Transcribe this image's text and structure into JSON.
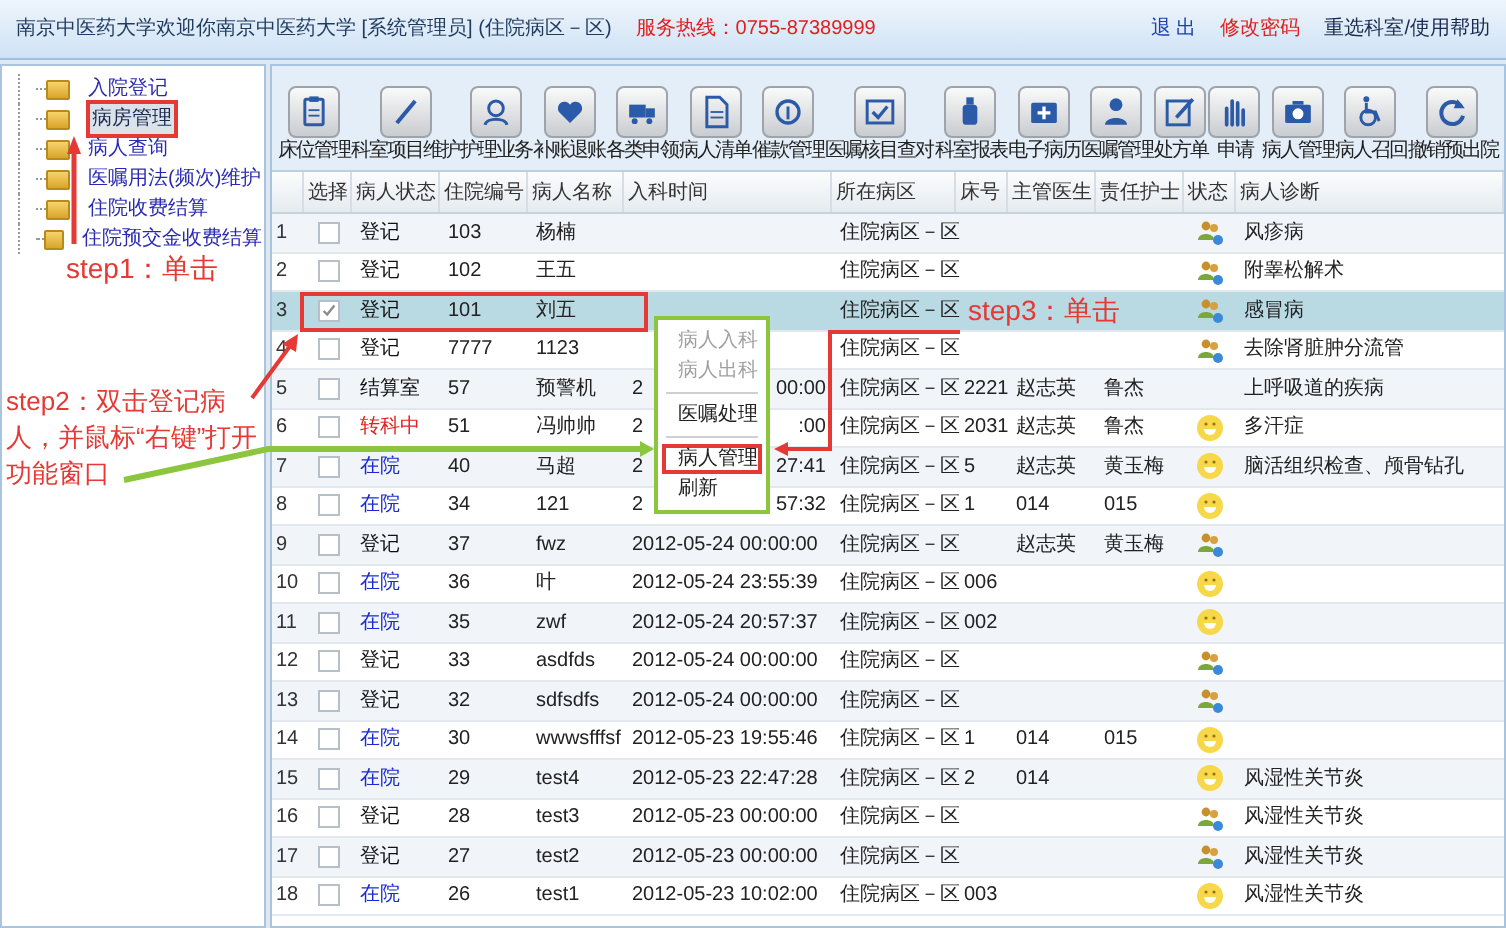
{
  "header": {
    "title": "南京中医药大学欢迎你南京中医药大学 [系统管理员] (住院病区－区)",
    "hotline": "服务热线：0755-87389999",
    "links": [
      "退 出",
      "修改密码",
      "重选科室/使用帮助"
    ]
  },
  "tree": {
    "items": [
      {
        "label": "入院登记",
        "selected": false
      },
      {
        "label": "病房管理",
        "selected": true
      },
      {
        "label": "病人查询",
        "selected": false
      },
      {
        "label": "医嘱用法(频次)维护",
        "selected": false
      },
      {
        "label": "住院收费结算",
        "selected": false
      },
      {
        "label": "住院预交金收费结算",
        "selected": false
      }
    ]
  },
  "toolbar": [
    {
      "label": "床位管理"
    },
    {
      "label": "科室项目维护"
    },
    {
      "label": "护理业务"
    },
    {
      "label": "补账退账"
    },
    {
      "label": "各类申领"
    },
    {
      "label": "病人清单"
    },
    {
      "label": "催款管理"
    },
    {
      "label": "医嘱核目查对"
    },
    {
      "label": "科室报表"
    },
    {
      "label": "电子病历"
    },
    {
      "label": "医嘱管理"
    },
    {
      "label": "处方单"
    },
    {
      "label": "申请"
    },
    {
      "label": "病人管理"
    },
    {
      "label": "病人召回"
    },
    {
      "label": "撤销预出院"
    }
  ],
  "table": {
    "columns": [
      "选择",
      "病人状态",
      "住院编号",
      "病人名称",
      "入科时间",
      "所在病区",
      "床号",
      "主管医生",
      "责任护士",
      "状态",
      "病人诊断"
    ],
    "rows": [
      {
        "no": "1",
        "checked": false,
        "selected": false,
        "kind": "registered",
        "status": "登记",
        "id": "103",
        "name": "杨楠",
        "time": "",
        "ward": "住院病区－区",
        "bed": "",
        "doctor": "",
        "nurse": "",
        "diagnosis": "风疹病"
      },
      {
        "no": "2",
        "checked": false,
        "selected": false,
        "kind": "registered",
        "status": "登记",
        "id": "102",
        "name": "王五",
        "time": "",
        "ward": "住院病区－区",
        "bed": "",
        "doctor": "",
        "nurse": "",
        "diagnosis": "附睾松解术"
      },
      {
        "no": "3",
        "checked": true,
        "selected": true,
        "kind": "registered",
        "status": "登记",
        "id": "101",
        "name": "刘五",
        "time": "",
        "ward": "住院病区－区",
        "bed": "",
        "doctor": "",
        "nurse": "",
        "diagnosis": "感冒病"
      },
      {
        "no": "4",
        "checked": false,
        "selected": false,
        "kind": "registered",
        "status": "登记",
        "id": "7777",
        "name": "1123",
        "time": "",
        "ward": "住院病区－区",
        "bed": "",
        "doctor": "",
        "nurse": "",
        "diagnosis": "去除肾脏肿分流管"
      },
      {
        "no": "5",
        "checked": false,
        "selected": false,
        "kind": "settling",
        "status": "结算室",
        "id": "57",
        "name": "预警机",
        "time": "2",
        "time_end": "00:00",
        "ward": "住院病区－区",
        "bed": "2221",
        "doctor": "赵志英",
        "nurse": "鲁杰",
        "diagnosis": "上呼吸道的疾病"
      },
      {
        "no": "6",
        "checked": false,
        "selected": false,
        "kind": "transferring",
        "status": "转科中",
        "id": "51",
        "name": "冯帅帅",
        "time": "2",
        "time_end": ":00",
        "ward": "住院病区－区",
        "bed": "2031",
        "doctor": "赵志英",
        "nurse": "鲁杰",
        "diagnosis": "多汗症"
      },
      {
        "no": "7",
        "checked": false,
        "selected": false,
        "kind": "admitted",
        "status": "在院",
        "id": "40",
        "name": "马超",
        "time": "2",
        "time_end": "27:41",
        "ward": "住院病区－区",
        "bed": "5",
        "doctor": "赵志英",
        "nurse": "黄玉梅",
        "diagnosis": "脑活组织检查、颅骨钻孔"
      },
      {
        "no": "8",
        "checked": false,
        "selected": false,
        "kind": "admitted",
        "status": "在院",
        "id": "34",
        "name": "121",
        "time": "2",
        "time_end": "57:32",
        "ward": "住院病区－区",
        "bed": "1",
        "doctor": "014",
        "nurse": "015",
        "diagnosis": ""
      },
      {
        "no": "9",
        "checked": false,
        "selected": false,
        "kind": "registered",
        "status": "登记",
        "id": "37",
        "name": "fwz",
        "time": "2012-05-24 00:00:00",
        "ward": "住院病区－区",
        "bed": "",
        "doctor": "赵志英",
        "nurse": "黄玉梅",
        "diagnosis": ""
      },
      {
        "no": "10",
        "checked": false,
        "selected": false,
        "kind": "admitted",
        "status": "在院",
        "id": "36",
        "name": "叶",
        "time": "2012-05-24 23:55:39",
        "ward": "住院病区－区",
        "bed": "006",
        "doctor": "",
        "nurse": "",
        "diagnosis": ""
      },
      {
        "no": "11",
        "checked": false,
        "selected": false,
        "kind": "admitted",
        "status": "在院",
        "id": "35",
        "name": "zwf",
        "time": "2012-05-24 20:57:37",
        "ward": "住院病区－区",
        "bed": "002",
        "doctor": "",
        "nurse": "",
        "diagnosis": ""
      },
      {
        "no": "12",
        "checked": false,
        "selected": false,
        "kind": "registered",
        "status": "登记",
        "id": "33",
        "name": "asdfds",
        "time": "2012-05-24 00:00:00",
        "ward": "住院病区－区",
        "bed": "",
        "doctor": "",
        "nurse": "",
        "diagnosis": ""
      },
      {
        "no": "13",
        "checked": false,
        "selected": false,
        "kind": "registered",
        "status": "登记",
        "id": "32",
        "name": "sdfsdfs",
        "time": "2012-05-24 00:00:00",
        "ward": "住院病区－区",
        "bed": "",
        "doctor": "",
        "nurse": "",
        "diagnosis": ""
      },
      {
        "no": "14",
        "checked": false,
        "selected": false,
        "kind": "admitted",
        "status": "在院",
        "id": "30",
        "name": "wwwsfffsf",
        "time": "2012-05-23 19:55:46",
        "ward": "住院病区－区",
        "bed": "1",
        "doctor": "014",
        "nurse": "015",
        "diagnosis": ""
      },
      {
        "no": "15",
        "checked": false,
        "selected": false,
        "kind": "admitted",
        "status": "在院",
        "id": "29",
        "name": "test4",
        "time": "2012-05-23 22:47:28",
        "ward": "住院病区－区",
        "bed": "2",
        "doctor": "014",
        "nurse": "",
        "diagnosis": "风湿性关节炎"
      },
      {
        "no": "16",
        "checked": false,
        "selected": false,
        "kind": "registered",
        "status": "登记",
        "id": "28",
        "name": "test3",
        "time": "2012-05-23 00:00:00",
        "ward": "住院病区－区",
        "bed": "",
        "doctor": "",
        "nurse": "",
        "diagnosis": "风湿性关节炎"
      },
      {
        "no": "17",
        "checked": false,
        "selected": false,
        "kind": "registered",
        "status": "登记",
        "id": "27",
        "name": "test2",
        "time": "2012-05-23 00:00:00",
        "ward": "住院病区－区",
        "bed": "",
        "doctor": "",
        "nurse": "",
        "diagnosis": "风湿性关节炎"
      },
      {
        "no": "18",
        "checked": false,
        "selected": false,
        "kind": "admitted",
        "status": "在院",
        "id": "26",
        "name": "test1",
        "time": "2012-05-23 10:02:00",
        "ward": "住院病区－区",
        "bed": "003",
        "doctor": "",
        "nurse": "",
        "diagnosis": "风湿性关节炎"
      }
    ]
  },
  "context_menu": {
    "items": [
      {
        "kind": "item",
        "label": "病人入科",
        "disabled": true,
        "highlighted": false
      },
      {
        "kind": "item",
        "label": "病人出科",
        "disabled": true,
        "highlighted": false
      },
      {
        "kind": "separator"
      },
      {
        "kind": "item",
        "label": "医嘱处理",
        "disabled": false,
        "highlighted": false
      },
      {
        "kind": "separator"
      },
      {
        "kind": "item",
        "label": "病人管理",
        "disabled": false,
        "highlighted": true
      },
      {
        "kind": "item",
        "label": "刷新",
        "disabled": false,
        "highlighted": false
      }
    ]
  },
  "annotations": [
    {
      "text": "step1：单击"
    },
    {
      "text": "step2：双击登记病人，并鼠标“右键”打开功能窗口"
    },
    {
      "text": "step3：单击"
    }
  ]
}
